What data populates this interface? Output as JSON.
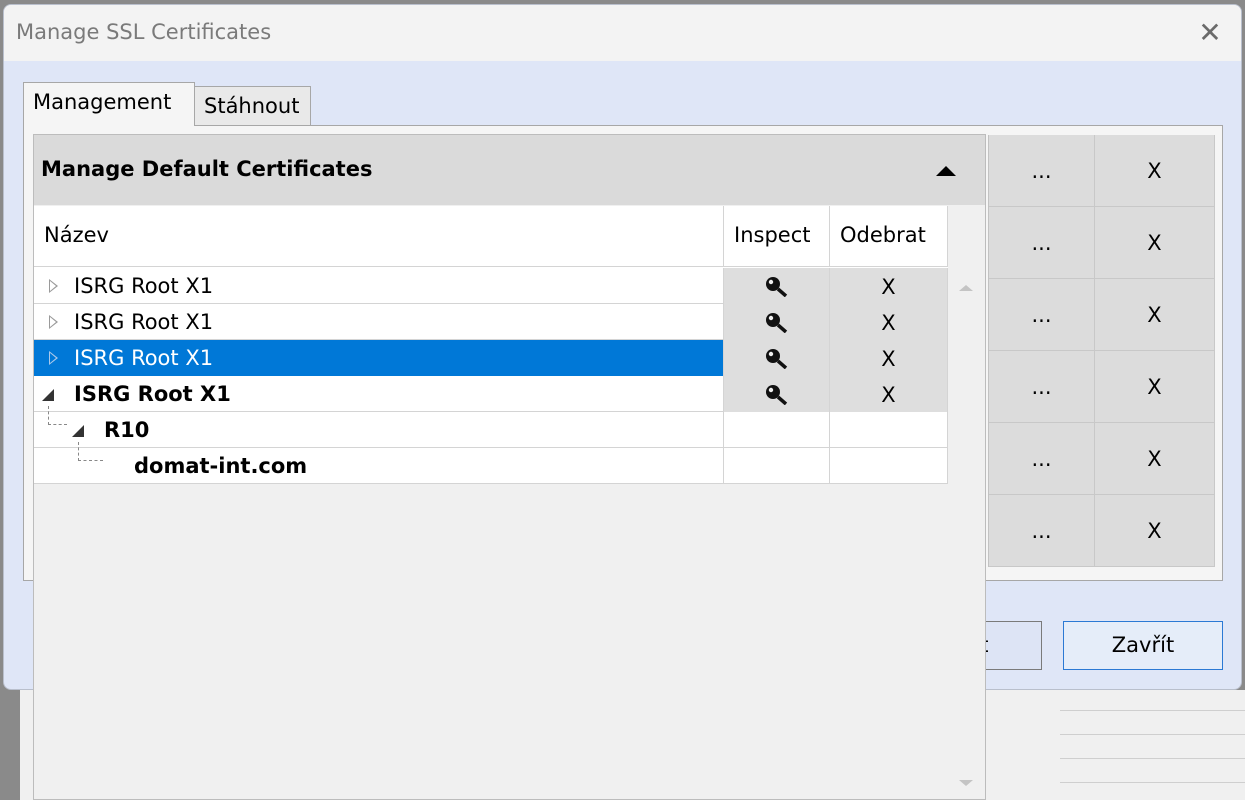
{
  "window": {
    "title": "Manage SSL Certificates"
  },
  "tabs": [
    {
      "label": "Management"
    },
    {
      "label": "Stáhnout"
    }
  ],
  "right_grid": {
    "rows": [
      {
        "more": "...",
        "remove": "X"
      },
      {
        "more": "...",
        "remove": "X"
      },
      {
        "more": "...",
        "remove": "X"
      },
      {
        "more": "...",
        "remove": "X"
      },
      {
        "more": "...",
        "remove": "X"
      },
      {
        "more": "...",
        "remove": "X"
      }
    ]
  },
  "buttons": {
    "partial_label": "nt",
    "close_label": "Zavřít"
  },
  "popup": {
    "title": "Manage Default Certificates",
    "columns": {
      "name": "Název",
      "inspect": "Inspect",
      "remove": "Odebrat"
    },
    "rows": [
      {
        "name": "ISRG Root X1",
        "remove": "X"
      },
      {
        "name": "ISRG Root X1",
        "remove": "X"
      },
      {
        "name": "ISRG Root X1",
        "remove": "X"
      },
      {
        "name": "ISRG Root X1",
        "remove": "X"
      },
      {
        "name": "R10"
      },
      {
        "name": "domat-int.com"
      }
    ]
  },
  "icons": {
    "inspect": "magnifier-icon",
    "expander": "triangle-icon",
    "collapse": "caret-up-icon"
  },
  "colors": {
    "selection": "#0078d7",
    "accent_border": "#2b79d4"
  }
}
